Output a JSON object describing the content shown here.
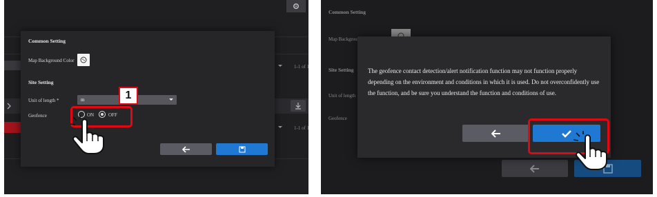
{
  "left": {
    "step_number": "1",
    "dialog": {
      "section_common": "Common Setting",
      "map_bg_label": "Map Background Color",
      "section_site": "Site Setting",
      "unit_label": "Unit of length *",
      "unit_value": "m",
      "geofence_label": "Geofence",
      "option_on": "ON",
      "option_off": "OFF",
      "geofence_selected": "OFF"
    },
    "background": {
      "pagination_1": "1-1 of 1",
      "pagination_2": "1-1 of 1"
    }
  },
  "right": {
    "background": {
      "section_common": "Common Setting",
      "map_bg_label": "Map Background Color",
      "section_site": "Site Setting",
      "unit_label": "Unit of length",
      "geofence_label": "Geofence"
    },
    "dialog": {
      "message": "The geofence contact detection/alert notification function may not function properly depending on the environment and conditions in which it is used. Do not overconfidently use the function, and be sure you understand the function and conditions of use."
    }
  },
  "colors": {
    "highlight_red": "#e30613",
    "confirm_blue": "#1f78d1",
    "back_grey": "#5b5b63"
  },
  "icons": [
    "gear-icon",
    "download-icon",
    "chevron-right-icon",
    "dropdown-arrow-icon",
    "back-arrow-icon",
    "save-icon",
    "checkmark-icon",
    "hand-pointer-icon",
    "color-palette-icon"
  ]
}
